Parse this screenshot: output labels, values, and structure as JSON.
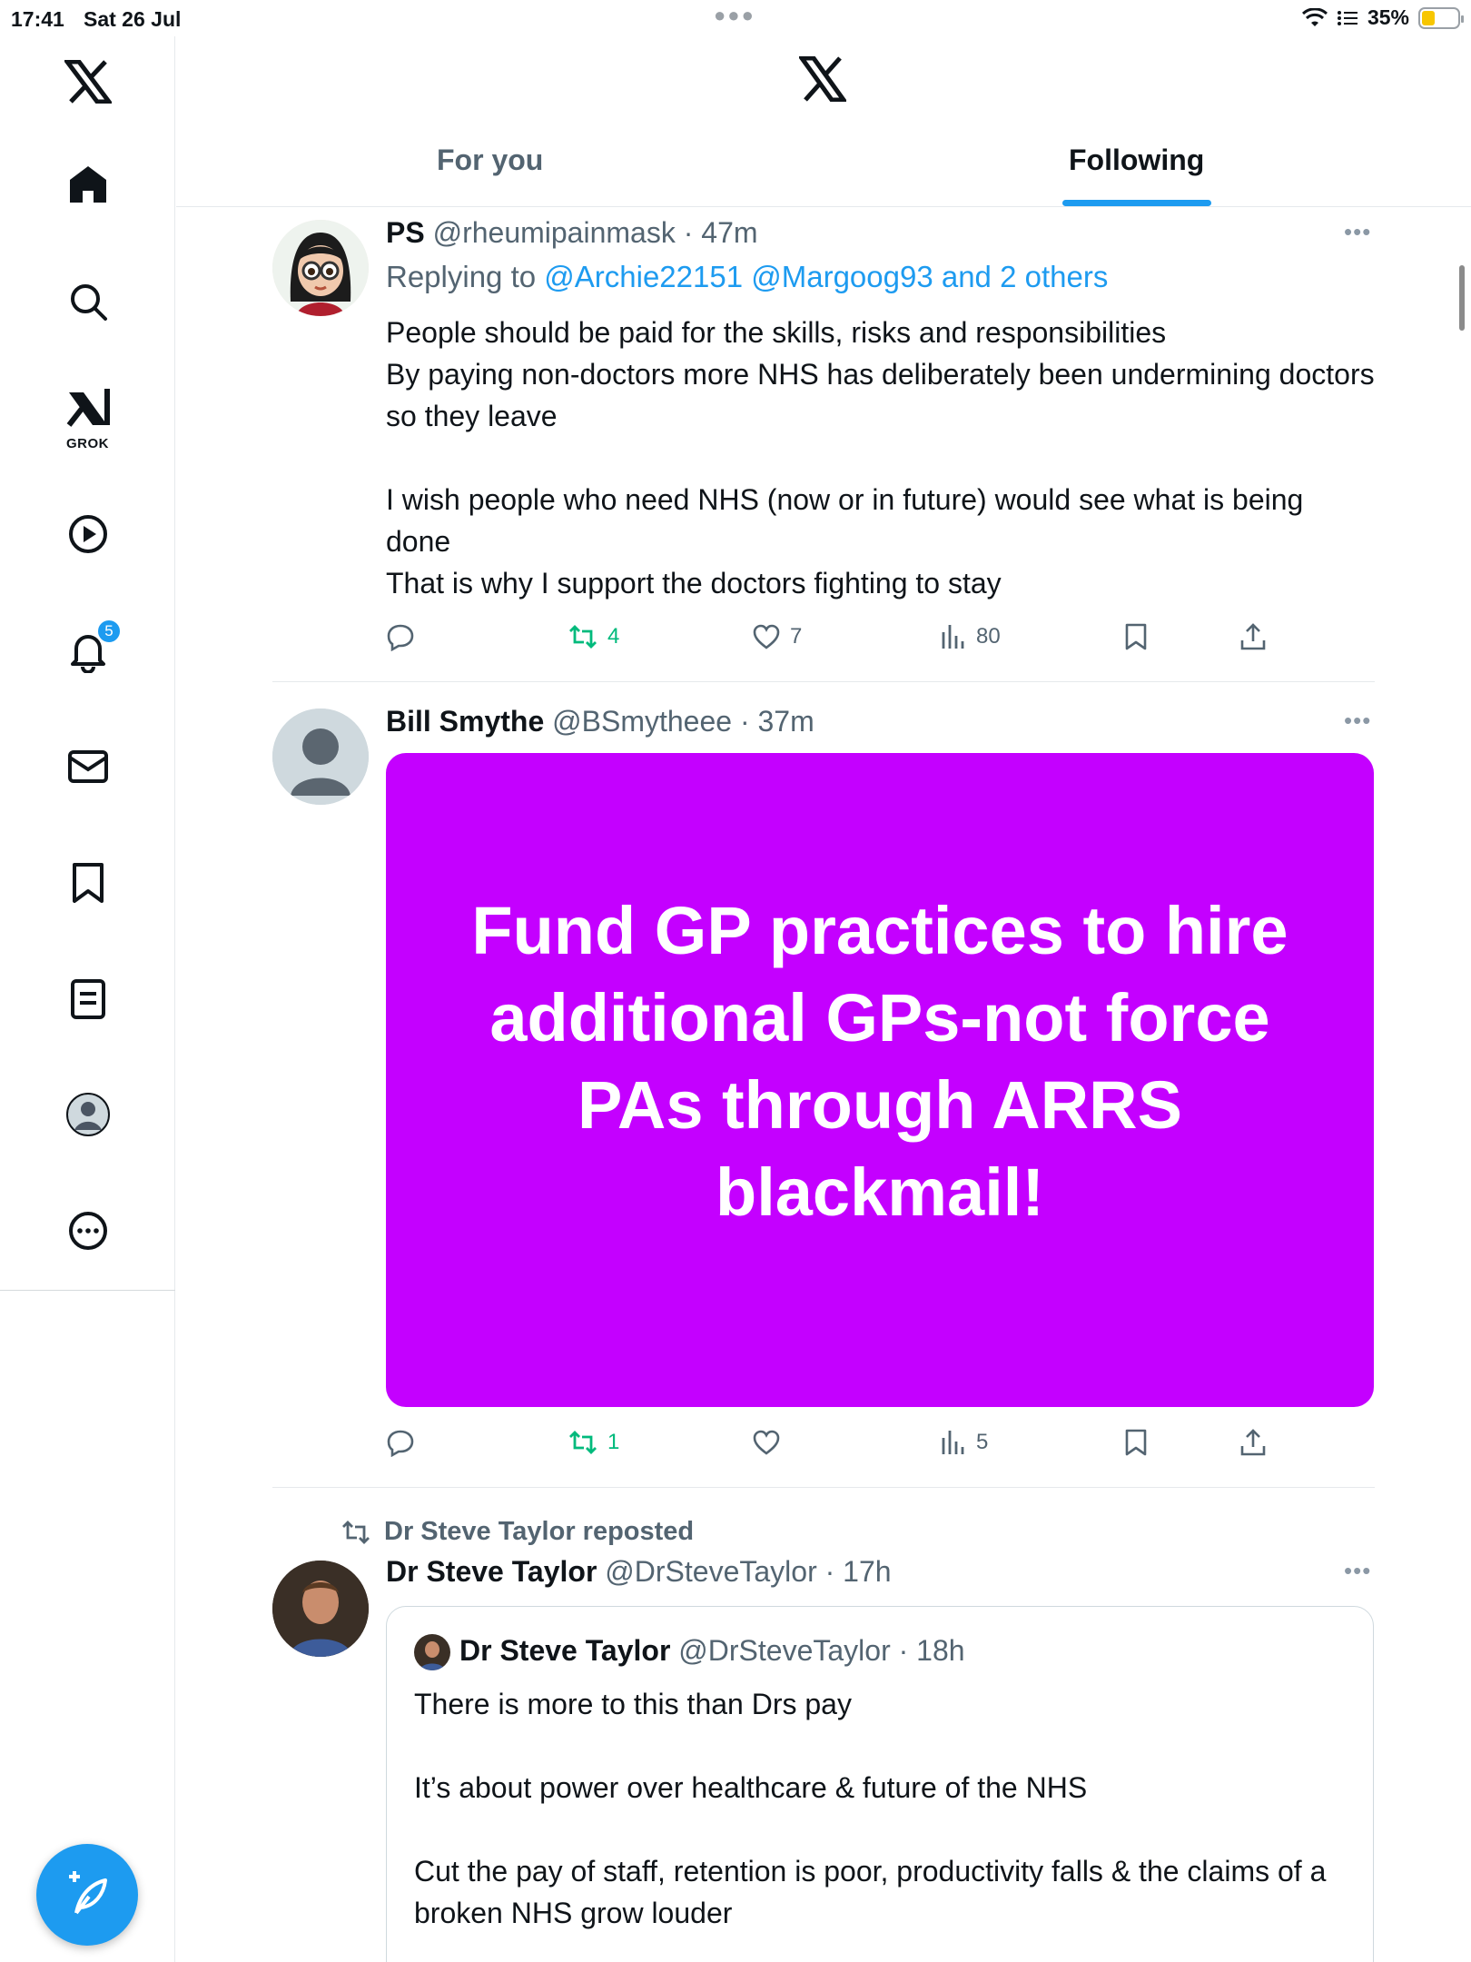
{
  "status_bar": {
    "time": "17:41",
    "date": "Sat 26 Jul",
    "battery": "35%"
  },
  "sidebar": {
    "grok_label": "GROK",
    "notification_count": "5"
  },
  "header": {
    "tabs": [
      {
        "label": "For you",
        "selected": false
      },
      {
        "label": "Following",
        "selected": true
      }
    ]
  },
  "tweets": [
    {
      "name": "PS",
      "handle": "@rheumipainmask",
      "time": "· 47m",
      "replying_prefix": "Replying to ",
      "replying_to": "@Archie22151 @Margoog93 and 2 others",
      "text": "People should be paid for the skills, risks and responsibilities\nBy paying non-doctors more NHS has deliberately been undermining doctors so they leave\n\nI wish people who need NHS (now or in future) would see what is being done\nThat is why I support the doctors fighting to stay",
      "reposts": "4",
      "likes": "7",
      "views": "80"
    },
    {
      "name": "Bill Smythe",
      "handle": "@BSmytheee",
      "time": "· 37m",
      "media_text": "Fund GP practices  to hire additional GPs-not force PAs through ARRS blackmail!",
      "media_color": "#c400ff",
      "reposts": "1",
      "likes": "",
      "views": "5"
    },
    {
      "repost_label": "Dr Steve Taylor reposted",
      "name": "Dr Steve Taylor",
      "handle": "@DrSteveTaylor",
      "time": "· 17h",
      "quote": {
        "name": "Dr Steve Taylor",
        "handle": "@DrSteveTaylor",
        "time": "· 18h",
        "text": "There is more to this than Drs pay\n\nIt’s about power over healthcare & future of the NHS\n\nCut the pay of staff, retention is poor, productivity falls & the claims of a broken NHS grow louder"
      }
    }
  ],
  "colors": {
    "accent": "#1d9bf0",
    "repost_green": "#00ba7c",
    "secondary_text": "#536471"
  }
}
